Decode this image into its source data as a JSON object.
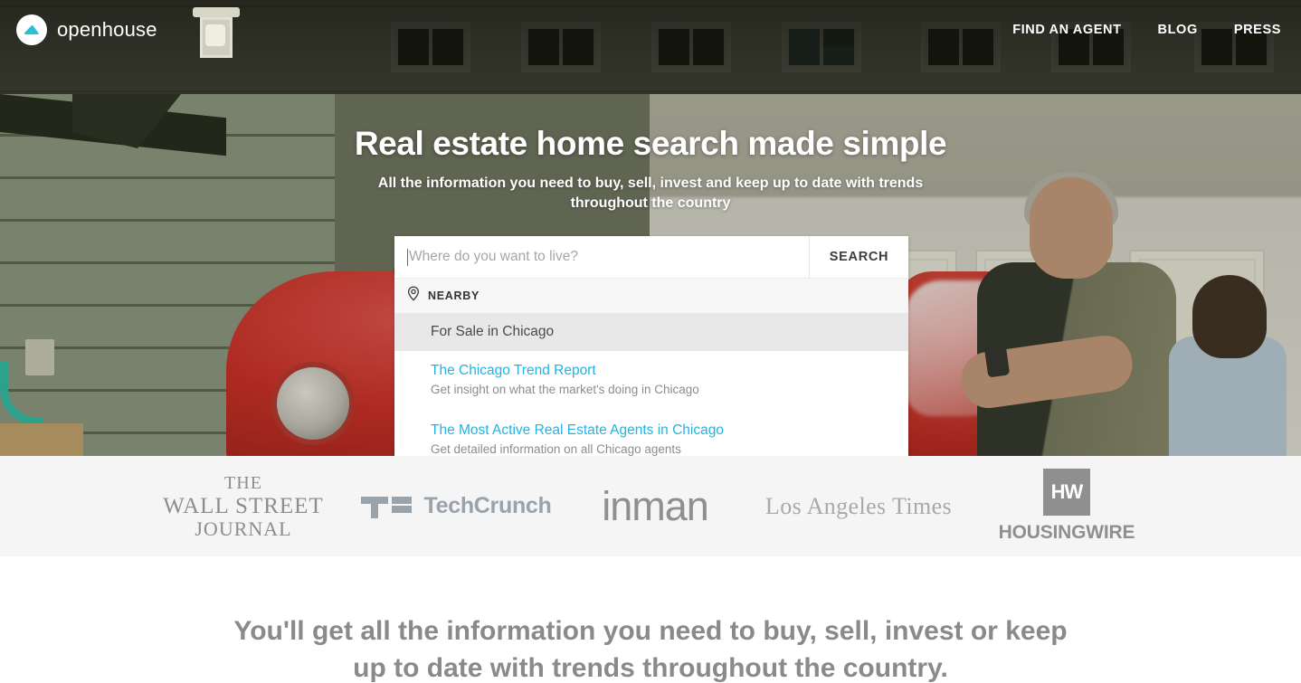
{
  "nav": {
    "brand_name": "openhouse",
    "brand_icon": "openhouse-roof-logo",
    "links": [
      {
        "label": "FIND AN AGENT"
      },
      {
        "label": "BLOG"
      },
      {
        "label": "PRESS"
      }
    ]
  },
  "hero": {
    "title": "Real estate home search made simple",
    "subtitle": "All the information you need to buy, sell, invest and keep up to date with trends throughout the country"
  },
  "search": {
    "placeholder": "Where do you want to live?",
    "value": "",
    "button_label": "SEARCH",
    "dropdown": {
      "section_label": "NEARBY",
      "section_icon": "map-pin-icon",
      "highlighted": {
        "label": "For Sale in Chicago"
      },
      "items": [
        {
          "title": "The Chicago Trend Report",
          "subtitle": "Get insight on what the market's doing in Chicago"
        },
        {
          "title": "The Most Active Real Estate Agents in Chicago",
          "subtitle": "Get detailed information on all Chicago agents"
        }
      ]
    }
  },
  "press": {
    "logos": [
      {
        "name": "The Wall Street Journal",
        "line1": "THE",
        "line2": "WALL STREET",
        "line3": "JOURNAL"
      },
      {
        "name": "TechCrunch",
        "text": "TechCrunch"
      },
      {
        "name": "Inman",
        "text": "inman"
      },
      {
        "name": "Los Angeles Times",
        "text": "Los Angeles Times"
      },
      {
        "name": "HousingWire",
        "mark": "HW",
        "text": "HOUSINGWIRE"
      }
    ]
  },
  "bottom": {
    "headline": "You'll get all the information you need to buy, sell, invest or keep up to date with trends throughout the country."
  },
  "colors": {
    "accent": "#22b3e0",
    "brand_mark": "#29c0da",
    "press_bg": "#f5f5f5",
    "highlight_row": "#e8e8e8",
    "muted_text": "#8a8a8a"
  }
}
